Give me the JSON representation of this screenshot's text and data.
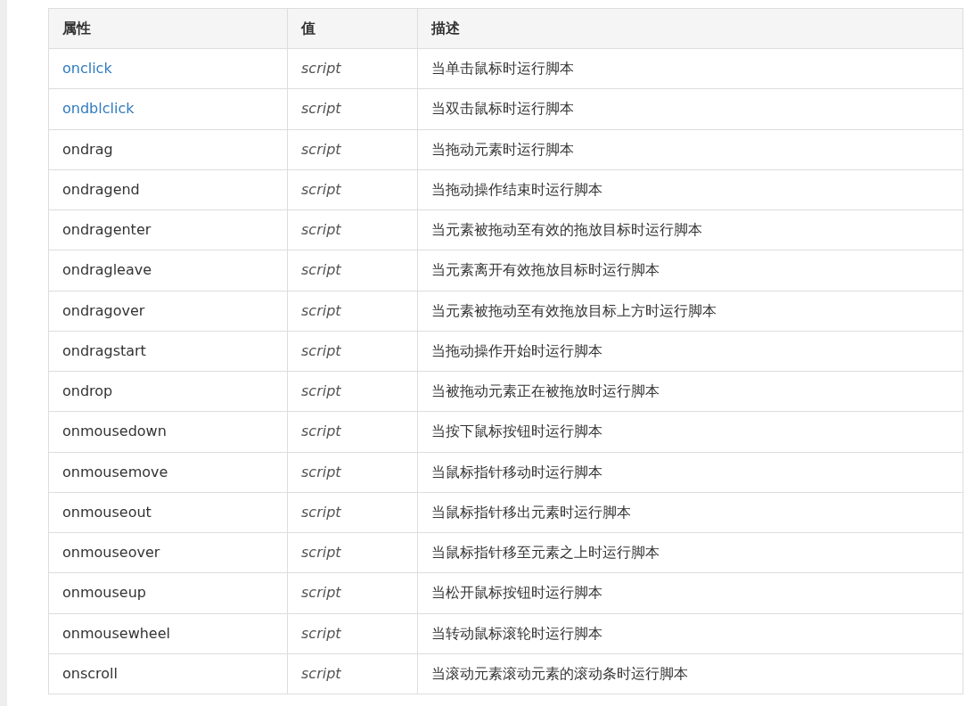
{
  "table": {
    "columns": [
      "属性",
      "值",
      "描述"
    ],
    "rows": [
      {
        "attribute": "onclick",
        "link": true,
        "value": "script",
        "description": "当单击鼠标时运行脚本"
      },
      {
        "attribute": "ondblclick",
        "link": true,
        "value": "script",
        "description": "当双击鼠标时运行脚本"
      },
      {
        "attribute": "ondrag",
        "link": false,
        "value": "script",
        "description": "当拖动元素时运行脚本"
      },
      {
        "attribute": "ondragend",
        "link": false,
        "value": "script",
        "description": "当拖动操作结束时运行脚本"
      },
      {
        "attribute": "ondragenter",
        "link": false,
        "value": "script",
        "description": "当元素被拖动至有效的拖放目标时运行脚本"
      },
      {
        "attribute": "ondragleave",
        "link": false,
        "value": "script",
        "description": "当元素离开有效拖放目标时运行脚本"
      },
      {
        "attribute": "ondragover",
        "link": false,
        "value": "script",
        "description": "当元素被拖动至有效拖放目标上方时运行脚本"
      },
      {
        "attribute": "ondragstart",
        "link": false,
        "value": "script",
        "description": "当拖动操作开始时运行脚本"
      },
      {
        "attribute": "ondrop",
        "link": false,
        "value": "script",
        "description": "当被拖动元素正在被拖放时运行脚本"
      },
      {
        "attribute": "onmousedown",
        "link": false,
        "value": "script",
        "description": "当按下鼠标按钮时运行脚本"
      },
      {
        "attribute": "onmousemove",
        "link": false,
        "value": "script",
        "description": "当鼠标指针移动时运行脚本"
      },
      {
        "attribute": "onmouseout",
        "link": false,
        "value": "script",
        "description": "当鼠标指针移出元素时运行脚本"
      },
      {
        "attribute": "onmouseover",
        "link": false,
        "value": "script",
        "description": "当鼠标指针移至元素之上时运行脚本"
      },
      {
        "attribute": "onmouseup",
        "link": false,
        "value": "script",
        "description": "当松开鼠标按钮时运行脚本"
      },
      {
        "attribute": "onmousewheel",
        "link": false,
        "value": "script",
        "description": "当转动鼠标滚轮时运行脚本"
      },
      {
        "attribute": "onscroll",
        "link": false,
        "value": "script",
        "description": "当滚动元素滚动元素的滚动条时运行脚本"
      }
    ]
  }
}
